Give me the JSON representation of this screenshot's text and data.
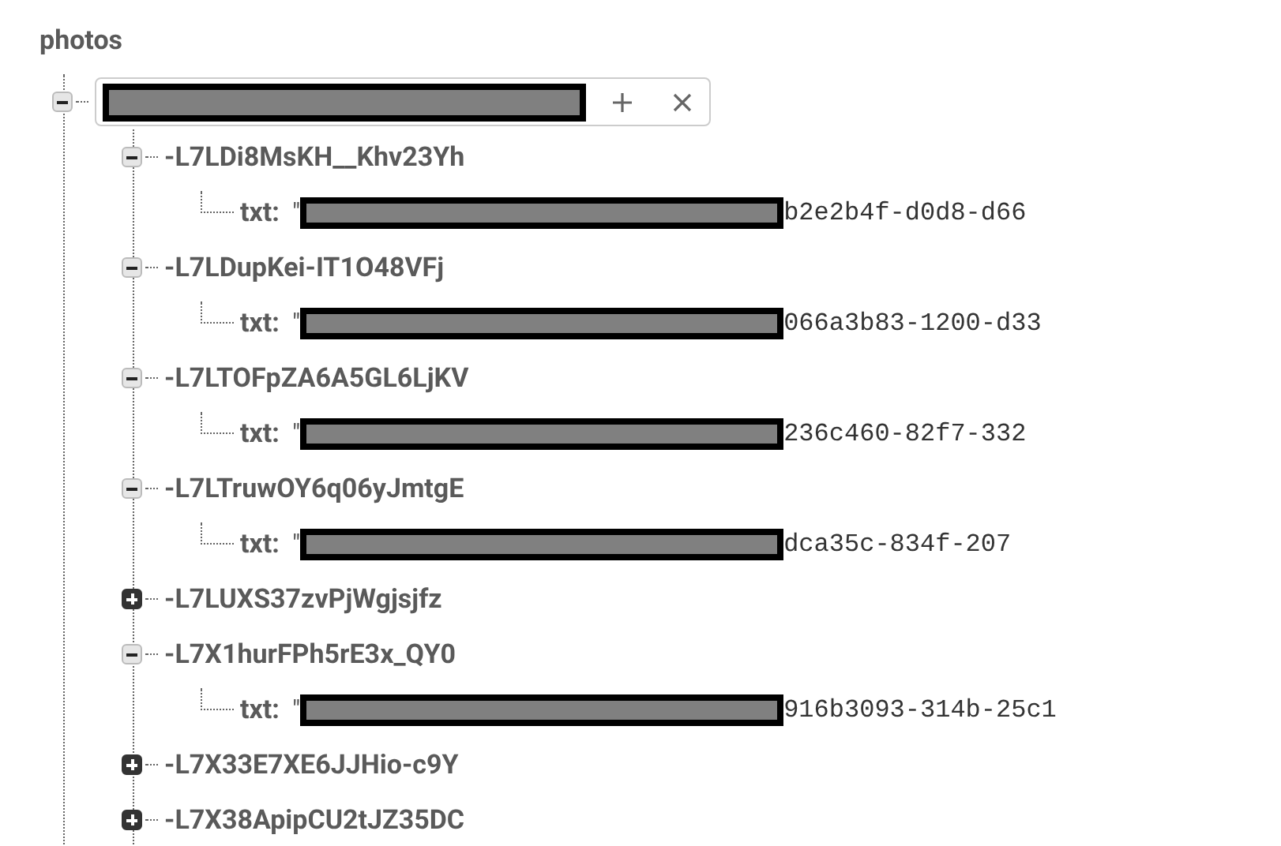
{
  "title": "photos",
  "root": {
    "expanded": true,
    "children": [
      {
        "key": "-L7LDi8MsKH__Khv23Yh",
        "expanded": true,
        "children": [
          {
            "key": "txt:",
            "quote": "\"",
            "value": "b2e2b4f-d0d8-d66"
          }
        ]
      },
      {
        "key": "-L7LDupKei-IT1O48VFj",
        "expanded": true,
        "children": [
          {
            "key": "txt:",
            "quote": "\"",
            "value": "066a3b83-1200-d33"
          }
        ]
      },
      {
        "key": "-L7LTOFpZA6A5GL6LjKV",
        "expanded": true,
        "children": [
          {
            "key": "txt:",
            "quote": "\"",
            "value": "236c460-82f7-332"
          }
        ]
      },
      {
        "key": "-L7LTruwOY6q06yJmtgE",
        "expanded": true,
        "children": [
          {
            "key": "txt:",
            "quote": "\"",
            "value": "dca35c-834f-207"
          }
        ]
      },
      {
        "key": "-L7LUXS37zvPjWgjsjfz",
        "expanded": false
      },
      {
        "key": "-L7X1hurFPh5rE3x_QY0",
        "expanded": true,
        "children": [
          {
            "key": "txt:",
            "quote": "\"",
            "value": "916b3093-314b-25c1"
          }
        ]
      },
      {
        "key": "-L7X33E7XE6JJHio-c9Y",
        "expanded": false
      },
      {
        "key": "-L7X38ApipCU2tJZ35DC",
        "expanded": false
      }
    ]
  }
}
